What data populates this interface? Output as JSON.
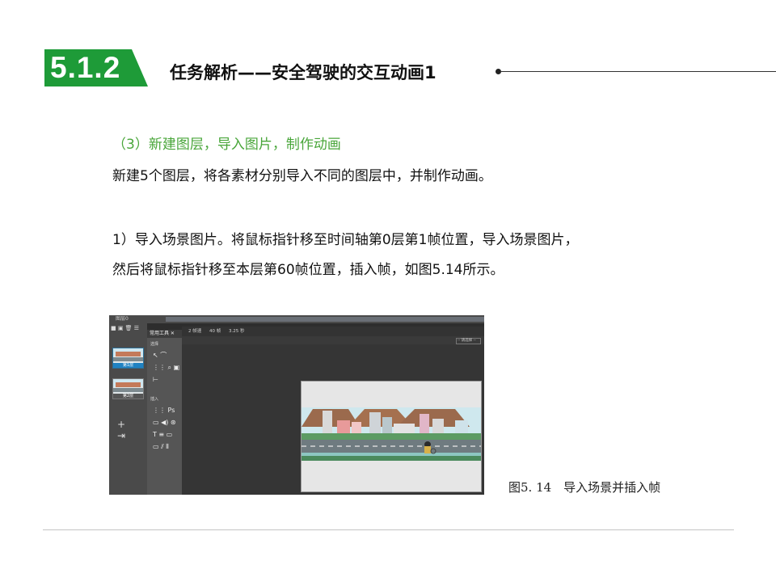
{
  "header": {
    "section_number": "5.1.2",
    "title": "任务解析——安全驾驶的交互动画1"
  },
  "content": {
    "subtitle": "（3）新建图层，导入图片，制作动画",
    "paragraph1": "新建5个图层，将各素材分别导入不同的图层中，并制作动画。",
    "step1_line1": "1）导入场景图片。将鼠标指针移至时间轴第0层第1帧位置，导入场景图片，",
    "step1_line2": "然后将鼠标指针移至本层第60帧位置，插入帧，如图5.14所示。"
  },
  "figure": {
    "caption": "图5. 14　导入场景并插入帧"
  },
  "screenshot": {
    "timeline_label": "图层0",
    "layer_panel_icons": "■ ▣ 🗑 ☰",
    "tool_panel_tab": "常用工具 ✕",
    "stage_info": [
      "2 帧速",
      "40 帧",
      "3.25 秒"
    ],
    "section_select": "选择",
    "section_insert": "插入",
    "layer1_label": "第1层",
    "layer2_label": "第2层",
    "layer_actions": "+ ⇥",
    "stage_select": "-- 请选择 --",
    "tools_select": "↖ ⌒ ⋮⋮ ⌕ ▣ ⊢",
    "tools_insert": "⋮⋮ Ps ▭ ◀) ⊛ T ≡ ▭ ▭ ⫽ ⦀",
    "colors": {
      "brand_green": "#1e9b38",
      "subtitle_green": "#49a63a"
    }
  }
}
